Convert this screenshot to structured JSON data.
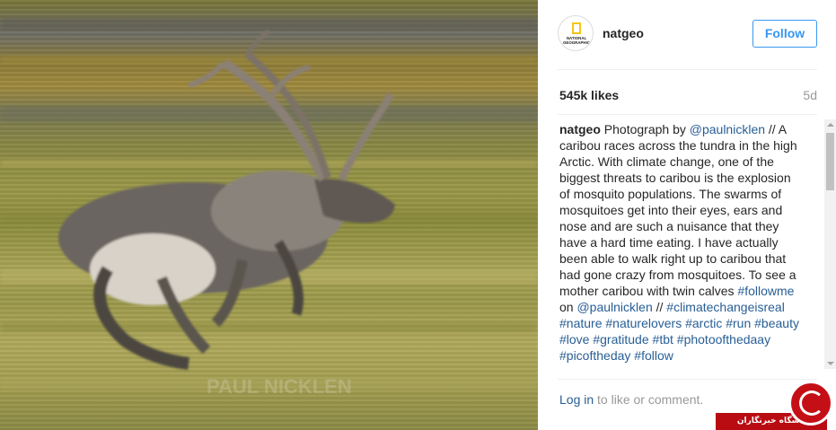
{
  "post": {
    "username": "natgeo",
    "avatar_brand": "NATIONAL GEOGRAPHIC",
    "follow_label": "Follow",
    "likes": "545k likes",
    "age": "5d",
    "caption": {
      "user": "natgeo",
      "segments": [
        {
          "type": "text",
          "text": " Photograph by "
        },
        {
          "type": "link",
          "text": "@paulnicklen"
        },
        {
          "type": "text",
          "text": " // A caribou races across the tundra in the high Arctic. With climate change, one of the biggest threats to caribou is the explosion of mosquito populations. The swarms of mosquitoes get into their eyes, ears and nose and are such a nuisance that they have a hard time eating. I have actually been able to walk right up to caribou that had gone crazy from mosquitoes. To see a mother caribou with twin calves "
        },
        {
          "type": "link",
          "text": "#followme"
        },
        {
          "type": "text",
          "text": " on "
        },
        {
          "type": "link",
          "text": "@paulnicklen"
        },
        {
          "type": "text",
          "text": " // "
        },
        {
          "type": "link",
          "text": "#climatechangeisreal"
        },
        {
          "type": "text",
          "text": " "
        },
        {
          "type": "link",
          "text": "#nature"
        },
        {
          "type": "text",
          "text": " "
        },
        {
          "type": "link",
          "text": "#naturelovers"
        },
        {
          "type": "text",
          "text": " "
        },
        {
          "type": "link",
          "text": "#arctic"
        },
        {
          "type": "text",
          "text": " "
        },
        {
          "type": "link",
          "text": "#run"
        },
        {
          "type": "text",
          "text": " "
        },
        {
          "type": "link",
          "text": "#beauty"
        },
        {
          "type": "text",
          "text": " "
        },
        {
          "type": "link",
          "text": "#love"
        },
        {
          "type": "text",
          "text": " "
        },
        {
          "type": "link",
          "text": "#gratitude"
        },
        {
          "type": "text",
          "text": " "
        },
        {
          "type": "link",
          "text": "#tbt"
        },
        {
          "type": "text",
          "text": " "
        },
        {
          "type": "link",
          "text": "#photoofthedaay"
        },
        {
          "type": "text",
          "text": " "
        },
        {
          "type": "link",
          "text": "#picoftheday"
        },
        {
          "type": "text",
          "text": " "
        },
        {
          "type": "link",
          "text": "#follow"
        }
      ]
    },
    "comment_prompt": {
      "login_label": "Log in",
      "rest": " to like or comment."
    }
  },
  "photo": {
    "watermark": "PAUL NICKLEN"
  },
  "watermark_badge": {
    "text": "باشگاه خبرنگاران"
  },
  "colors": {
    "link": "#275e95",
    "follow": "#3897f0",
    "muted": "#999999",
    "badge": "#b80b12"
  }
}
